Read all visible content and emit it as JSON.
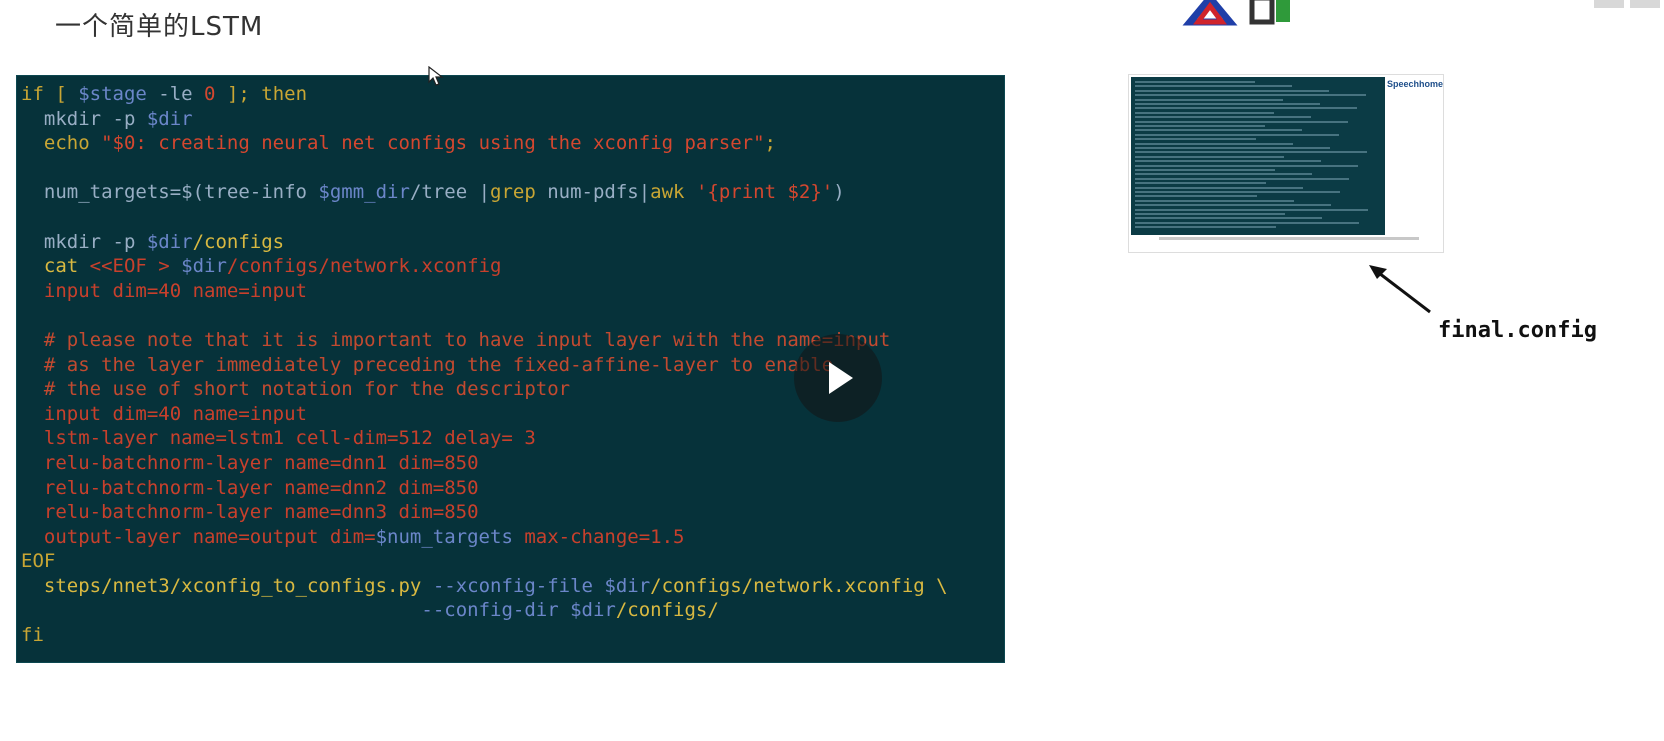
{
  "slide": {
    "title": "一个简单的LSTM"
  },
  "code": {
    "lines": [
      [
        [
          "kw",
          "if [ "
        ],
        [
          "var",
          "$stage"
        ],
        [
          "plain",
          " -le "
        ],
        [
          "num",
          "0"
        ],
        [
          "kw",
          " ]; then"
        ]
      ],
      [
        [
          "plain",
          "  mkdir -p "
        ],
        [
          "var",
          "$dir"
        ]
      ],
      [
        [
          "kw",
          "  echo "
        ],
        [
          "str",
          "\"$0: creating neural net configs using the xconfig parser\""
        ],
        [
          "kw",
          ";"
        ]
      ],
      [
        [
          "plain",
          ""
        ]
      ],
      [
        [
          "plain",
          "  num_targets=$(tree-info "
        ],
        [
          "var",
          "$gmm_dir"
        ],
        [
          "plain",
          "/tree |"
        ],
        [
          "kw",
          "grep"
        ],
        [
          "plain",
          " num-pdfs|"
        ],
        [
          "kw",
          "awk"
        ],
        [
          "str",
          " '{print $2}'"
        ],
        [
          "plain",
          ")"
        ]
      ],
      [
        [
          "plain",
          ""
        ]
      ],
      [
        [
          "plain",
          "  mkdir -p "
        ],
        [
          "var",
          "$dir"
        ],
        [
          "yellow",
          "/configs"
        ]
      ],
      [
        [
          "yellow",
          "  cat "
        ],
        [
          "red",
          "<<EOF > "
        ],
        [
          "var",
          "$dir"
        ],
        [
          "red",
          "/configs/network.xconfig"
        ]
      ],
      [
        [
          "red",
          "  input dim=40 name=input"
        ]
      ],
      [
        [
          "plain",
          ""
        ]
      ],
      [
        [
          "cmt",
          "  # please note that it is important to have input layer with the name=input"
        ]
      ],
      [
        [
          "cmt",
          "  # as the layer immediately preceding the fixed-affine-layer to enable"
        ]
      ],
      [
        [
          "cmt",
          "  # the use of short notation for the descriptor"
        ]
      ],
      [
        [
          "red",
          "  input dim=40 name=input"
        ]
      ],
      [
        [
          "red",
          "  lstm-layer name=lstm1 cell-dim=512 delay= 3"
        ]
      ],
      [
        [
          "red",
          "  relu-batchnorm-layer name=dnn1 dim=850"
        ]
      ],
      [
        [
          "red",
          "  relu-batchnorm-layer name=dnn2 dim=850"
        ]
      ],
      [
        [
          "red",
          "  relu-batchnorm-layer name=dnn3 dim=850"
        ]
      ],
      [
        [
          "red",
          "  output-layer name=output dim="
        ],
        [
          "var",
          "$num_targets"
        ],
        [
          "red",
          " max-change=1.5"
        ]
      ],
      [
        [
          "kw",
          "EOF"
        ]
      ],
      [
        [
          "yellow",
          "  steps/nnet3/xconfig_to_configs.py "
        ],
        [
          "var",
          "--xconfig-file $dir"
        ],
        [
          "yellow",
          "/configs/network.xconfig \\"
        ]
      ],
      [
        [
          "plain",
          "                                   "
        ],
        [
          "var",
          "--config-dir $dir"
        ],
        [
          "yellow",
          "/configs/"
        ]
      ],
      [
        [
          "kw",
          "fi"
        ]
      ]
    ]
  },
  "thumbnail": {
    "brand": "Speechhome"
  },
  "annotation": {
    "label": "final.config"
  },
  "colors": {
    "code_bg": "#06323a",
    "keyword": "#c9a634",
    "variable": "#6b86c9",
    "string": "#d4472f",
    "comment": "#c24a30"
  }
}
